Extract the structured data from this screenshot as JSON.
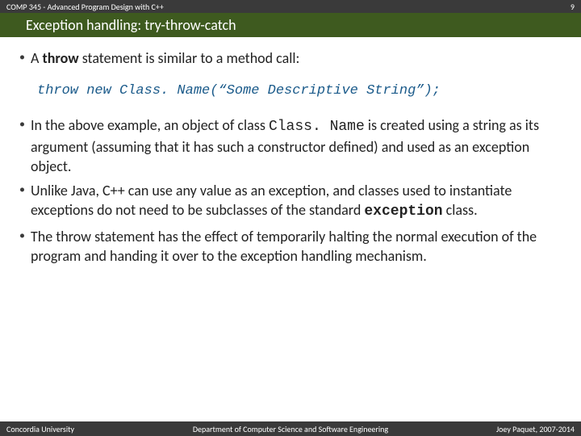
{
  "header": {
    "course": "COMP 345 - Advanced Program Design with C++",
    "page_number": "9"
  },
  "title": "Exception handling: try-throw-catch",
  "bullets": {
    "intro_pre": "A ",
    "intro_kw": "throw",
    "intro_post": " statement is similar to a method call:",
    "code": "throw new Class. Name(“Some Descriptive String”);",
    "b1_pre": "In the above example, an object of class ",
    "b1_class": "Class. Name",
    "b1_post": " is created using a string as its argument (assuming that it has such a constructor defined) and used as an exception object.",
    "b2_pre": "Unlike Java, C++ can use any value as an exception, and classes used to instantiate exceptions do not need to be subclasses of the standard ",
    "b2_kw": "exception",
    "b2_post": " class.",
    "b3": "The throw statement has the effect of temporarily halting the normal execution of the program and handing it over to the exception handling mechanism."
  },
  "footer": {
    "left": "Concordia University",
    "center": "Department of Computer Science and Software Engineering",
    "right": "Joey Paquet, 2007-2014"
  }
}
